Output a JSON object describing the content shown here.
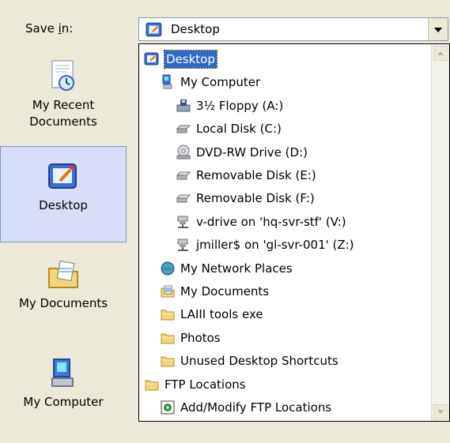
{
  "save_in": {
    "label_prefix": "Save ",
    "label_accel": "i",
    "label_suffix": "n:",
    "current": "Desktop"
  },
  "places": [
    {
      "label": "My Recent Documents",
      "icon": "recent-documents-icon"
    },
    {
      "label": "Desktop",
      "icon": "desktop-icon",
      "selected": true
    },
    {
      "label": "My Documents",
      "icon": "my-documents-icon"
    },
    {
      "label": "My Computer",
      "icon": "my-computer-icon"
    }
  ],
  "locations": [
    {
      "label": "Desktop",
      "icon": "desktop-icon",
      "indent": 0,
      "selected": true
    },
    {
      "label": "My Computer",
      "icon": "my-computer-icon",
      "indent": 1
    },
    {
      "label": "3½ Floppy (A:)",
      "icon": "floppy-drive-icon",
      "indent": 2
    },
    {
      "label": "Local Disk (C:)",
      "icon": "hard-disk-icon",
      "indent": 2
    },
    {
      "label": "DVD-RW Drive (D:)",
      "icon": "dvd-drive-icon",
      "indent": 2
    },
    {
      "label": "Removable Disk (E:)",
      "icon": "removable-disk-icon",
      "indent": 2
    },
    {
      "label": "Removable Disk (F:)",
      "icon": "removable-disk-icon",
      "indent": 2
    },
    {
      "label": "v-drive on 'hq-svr-stf' (V:)",
      "icon": "network-drive-icon",
      "indent": 2
    },
    {
      "label": "jmiller$ on 'gl-svr-001' (Z:)",
      "icon": "network-drive-icon",
      "indent": 2
    },
    {
      "label": "My Network Places",
      "icon": "network-places-icon",
      "indent": 1
    },
    {
      "label": "My Documents",
      "icon": "my-documents-icon",
      "indent": 1
    },
    {
      "label": "LAIII tools exe",
      "icon": "folder-icon",
      "indent": 1
    },
    {
      "label": "Photos",
      "icon": "folder-icon",
      "indent": 1
    },
    {
      "label": "Unused Desktop Shortcuts",
      "icon": "folder-icon",
      "indent": 1
    },
    {
      "label": "FTP Locations",
      "icon": "folder-icon",
      "indent": 0
    },
    {
      "label": "Add/Modify FTP Locations",
      "icon": "ftp-add-icon",
      "indent": 1
    }
  ]
}
